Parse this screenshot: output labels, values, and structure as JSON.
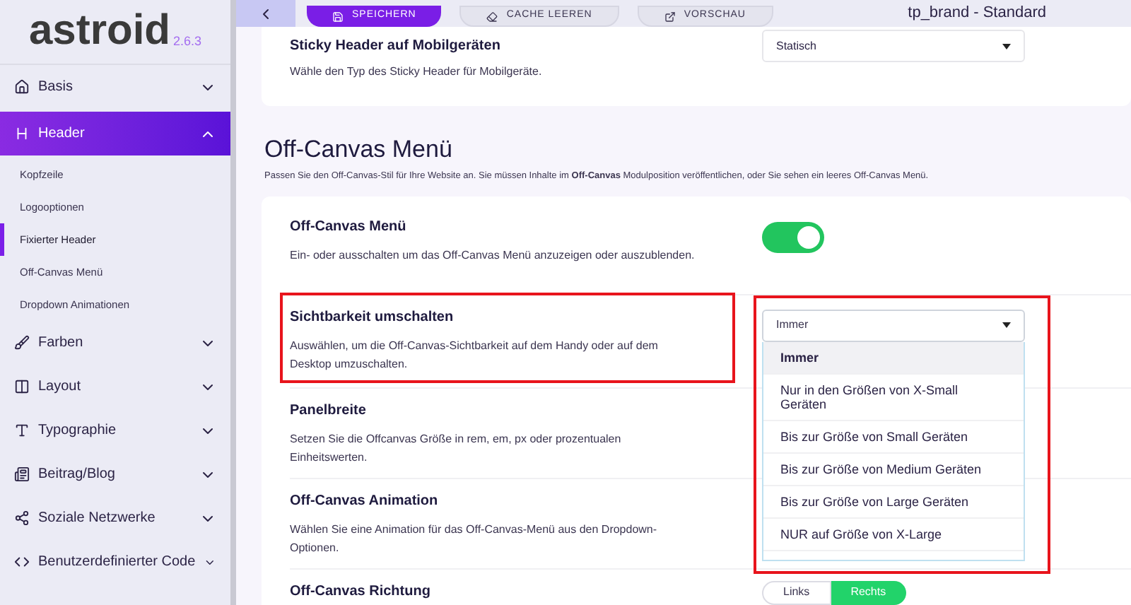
{
  "app": {
    "logo": "astroid",
    "version": "2.6.3"
  },
  "sidebar": {
    "items": [
      {
        "label": "Basis",
        "expanded": false,
        "selected": false
      },
      {
        "label": "Header",
        "expanded": true,
        "selected": true,
        "children": [
          {
            "label": "Kopfzeile",
            "selected": false
          },
          {
            "label": "Logooptionen",
            "selected": false
          },
          {
            "label": "Fixierter Header",
            "selected": true
          },
          {
            "label": "Off-Canvas Menü",
            "selected": false
          },
          {
            "label": "Dropdown Animationen",
            "selected": false
          }
        ]
      },
      {
        "label": "Farben",
        "expanded": false,
        "selected": false
      },
      {
        "label": "Layout",
        "expanded": false,
        "selected": false
      },
      {
        "label": "Typographie",
        "expanded": false,
        "selected": false
      },
      {
        "label": "Beitrag/Blog",
        "expanded": false,
        "selected": false
      },
      {
        "label": "Soziale Netzwerke",
        "expanded": false,
        "selected": false
      },
      {
        "label": "Benutzerdefinierter Code",
        "expanded": false,
        "selected": false
      }
    ]
  },
  "toolbar": {
    "buttons": [
      {
        "label": "SPEICHERN",
        "kind": "primary"
      },
      {
        "label": "CACHE LEEREN",
        "kind": "secondary"
      },
      {
        "label": "VORSCHAU",
        "kind": "secondary"
      }
    ],
    "title": "tp_brand - Standard"
  },
  "sticky_card": {
    "title": "Sticky Header auf Mobilgeräten",
    "description": "Wähle den Typ des Sticky Header für Mobilgeräte.",
    "value": "Statisch"
  },
  "section": {
    "title": "Off-Canvas Menü",
    "description": "Passen Sie den Off-Canvas-Stil für Ihre Website an. Sie müssen Inhalte im **Off-Canvas** Modulposition veröffentlichen, oder Sie sehen ein leeres Off-Canvas Menü."
  },
  "settings": [
    {
      "title": "Off-Canvas Menü",
      "description": "Ein- oder ausschalten um das Off-Canvas Menü anzuzeigen oder auszublenden.",
      "highlighted": false,
      "control": {
        "kind": "toggle",
        "on": true
      }
    },
    {
      "title": "Sichtbarkeit umschalten",
      "description": "Auswählen, um die Off-Canvas-Sichtbarkeit auf dem Handy oder auf dem Desktop umzuschalten.",
      "highlighted": true,
      "control": {
        "kind": "select",
        "value": "Immer",
        "highlighted": true,
        "expanded": true,
        "options": [
          {
            "label": "Immer",
            "selected": true
          },
          {
            "label": "Nur in den Größen von X-Small Geräten",
            "selected": false
          },
          {
            "label": "Bis zur Größe von Small Geräten",
            "selected": false
          },
          {
            "label": "Bis zur Größe von Medium Geräten",
            "selected": false
          },
          {
            "label": "Bis zur Größe von Large Geräten",
            "selected": false
          },
          {
            "label": "NUR auf Größe von X-Large",
            "selected": false
          }
        ]
      }
    },
    {
      "title": "Panelbreite",
      "description": "Setzen Sie die Offcanvas Größe in rem, em, px oder prozentualen Einheitswerten.",
      "highlighted": false
    },
    {
      "title": "Off-Canvas Animation",
      "description": "Wählen Sie eine Animation für das Off-Canvas-Menü aus den Dropdown-Optionen.",
      "highlighted": false
    },
    {
      "title": "Off-Canvas Richtung",
      "highlighted": false,
      "control": {
        "kind": "segmented",
        "options": [
          {
            "label": "Links",
            "selected": false
          },
          {
            "label": "Rechts",
            "selected": true
          }
        ]
      }
    }
  ]
}
